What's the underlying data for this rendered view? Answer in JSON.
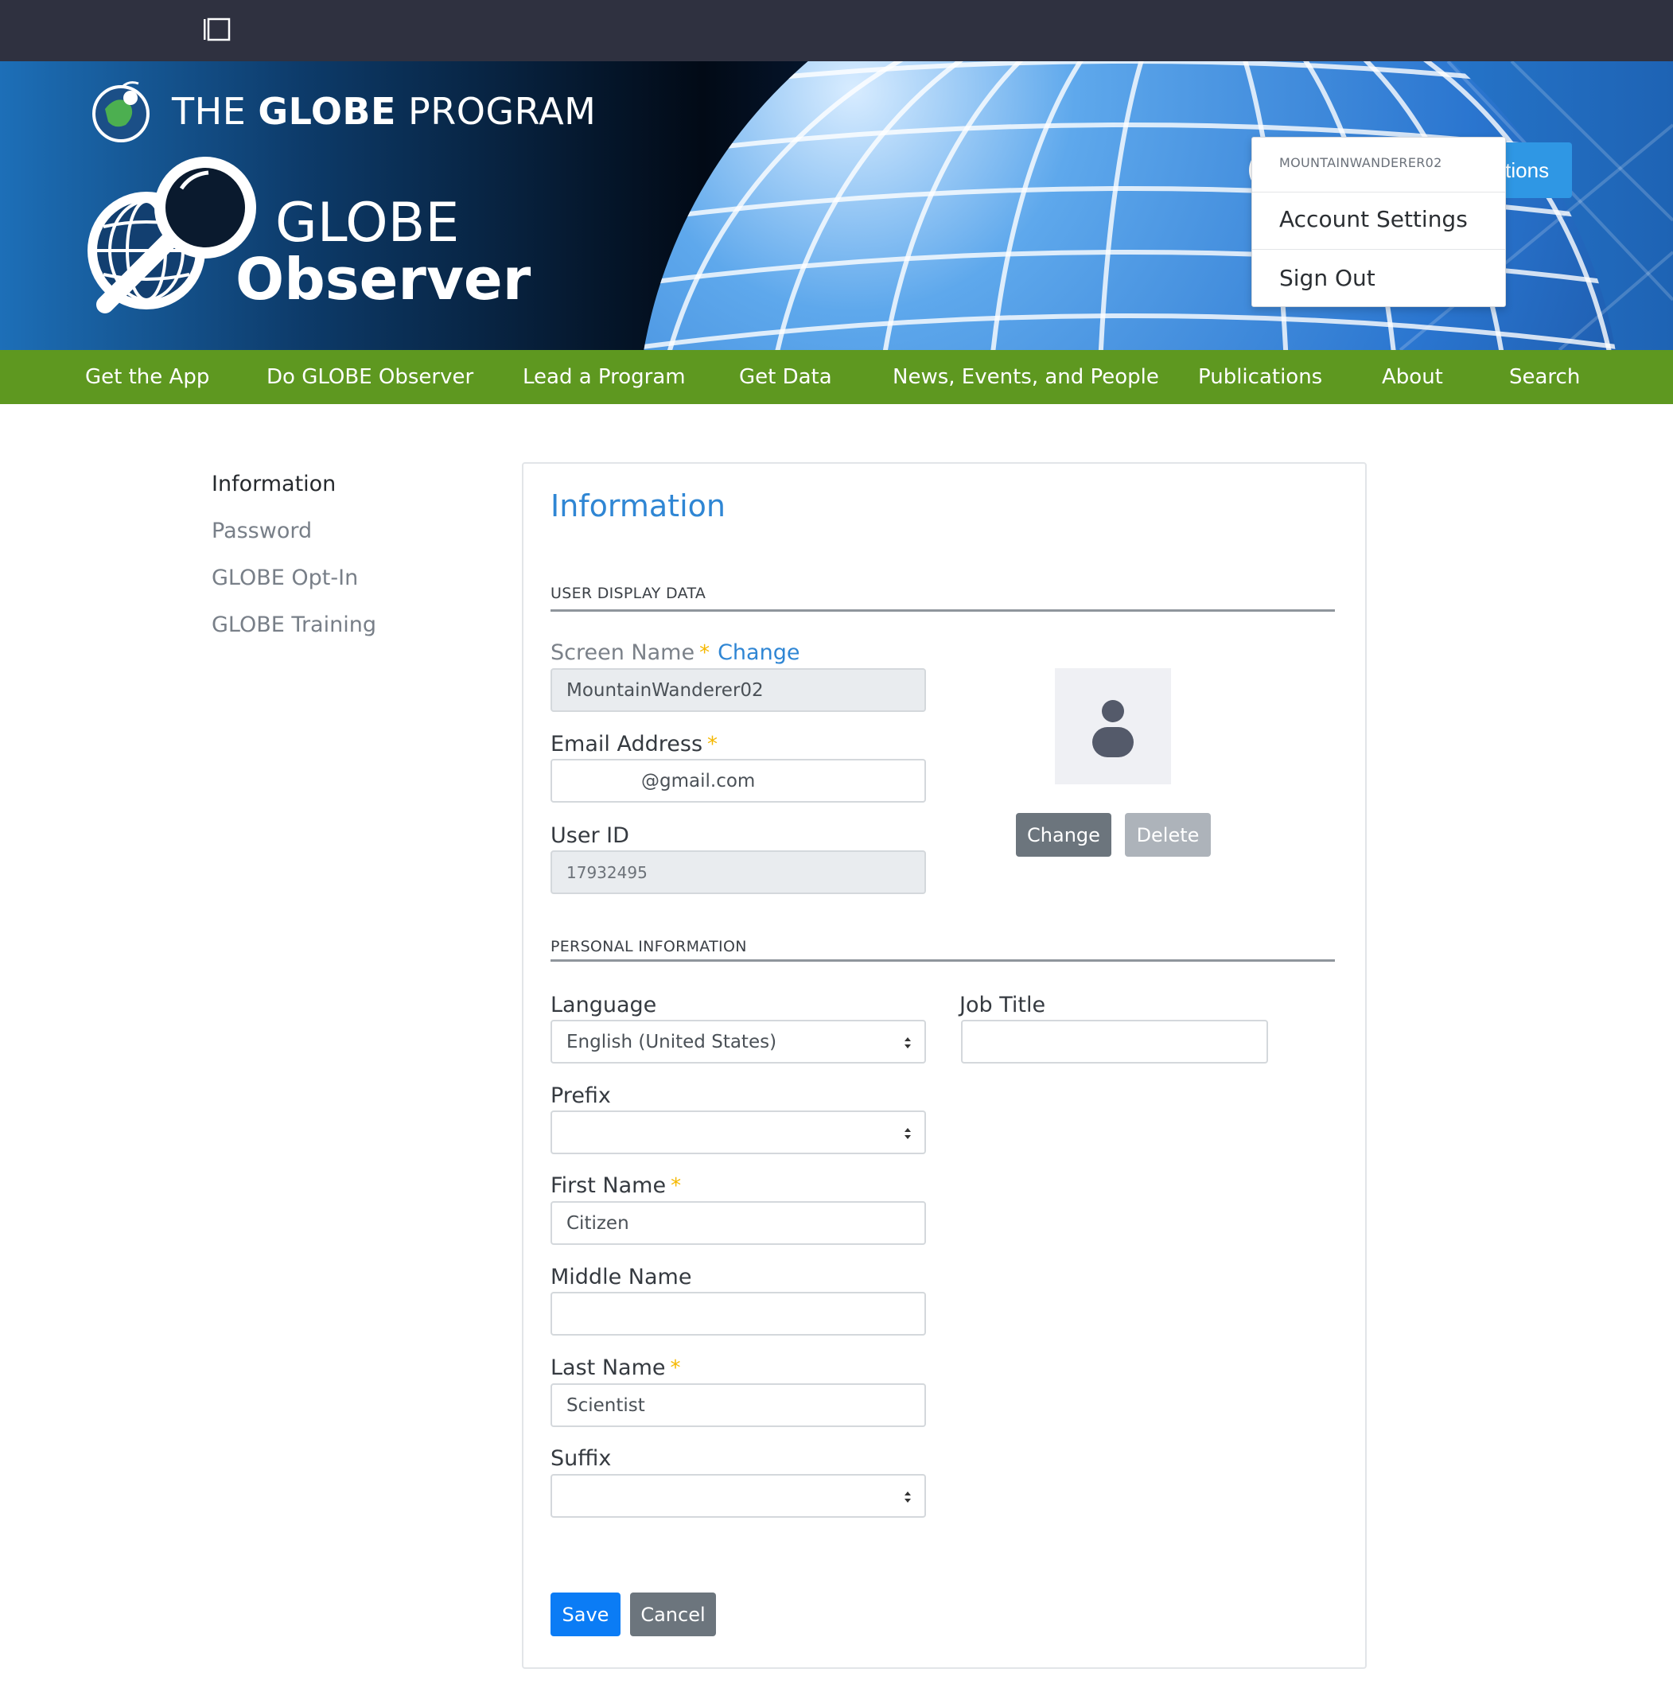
{
  "header": {
    "program_title_prefix": "THE",
    "program_title_bold": "GLOBE",
    "program_title_suffix": "PROGRAM",
    "brand_line1": "GLOBE",
    "brand_line2": "Observer",
    "view_observations_label": "View My Observations"
  },
  "user_menu": {
    "username": "MOUNTAINWANDERER02",
    "items": [
      {
        "label": "Account Settings"
      },
      {
        "label": "Sign Out"
      }
    ]
  },
  "nav": {
    "items": [
      {
        "label": "Get the App"
      },
      {
        "label": "Do GLOBE Observer"
      },
      {
        "label": "Lead a Program"
      },
      {
        "label": "Get Data"
      },
      {
        "label": "News, Events, and People"
      },
      {
        "label": "Publications"
      },
      {
        "label": "About"
      },
      {
        "label": "Search"
      }
    ]
  },
  "sidebar": {
    "items": [
      {
        "label": "Information",
        "active": true
      },
      {
        "label": "Password"
      },
      {
        "label": "GLOBE Opt-In"
      },
      {
        "label": "GLOBE Training"
      }
    ]
  },
  "form": {
    "title": "Information",
    "user_display_section": "USER DISPLAY DATA",
    "screen_name_label": "Screen Name",
    "screen_name_change_link": "Change",
    "screen_name_value": "MountainWanderer02",
    "email_label": "Email Address",
    "email_value": "@gmail.com",
    "user_id_label": "User ID",
    "user_id_value": "17932495",
    "photo_change_label": "Change",
    "photo_delete_label": "Delete",
    "personal_section": "PERSONAL INFORMATION",
    "language_label": "Language",
    "language_value": "English (United States)",
    "job_title_label": "Job Title",
    "job_title_value": "",
    "prefix_label": "Prefix",
    "prefix_value": "",
    "first_name_label": "First Name",
    "first_name_value": "Citizen",
    "middle_name_label": "Middle Name",
    "middle_name_value": "",
    "last_name_label": "Last Name",
    "last_name_value": "Scientist",
    "suffix_label": "Suffix",
    "suffix_value": "",
    "required_marker": "*",
    "save_label": "Save",
    "cancel_label": "Cancel"
  },
  "colors": {
    "top_bar": "#2f3140",
    "nav_green": "#5e9820",
    "accent_blue": "#2f86d4",
    "save_blue": "#0b7cf5",
    "secondary_gray": "#6c757d",
    "required_star": "#f5b800"
  },
  "icons": {
    "sidebar_toggle": "sidebar-toggle-icon",
    "user_avatar": "user-avatar-icon",
    "profile_photo": "person-placeholder-icon",
    "select_caret": "select-caret-icon"
  }
}
